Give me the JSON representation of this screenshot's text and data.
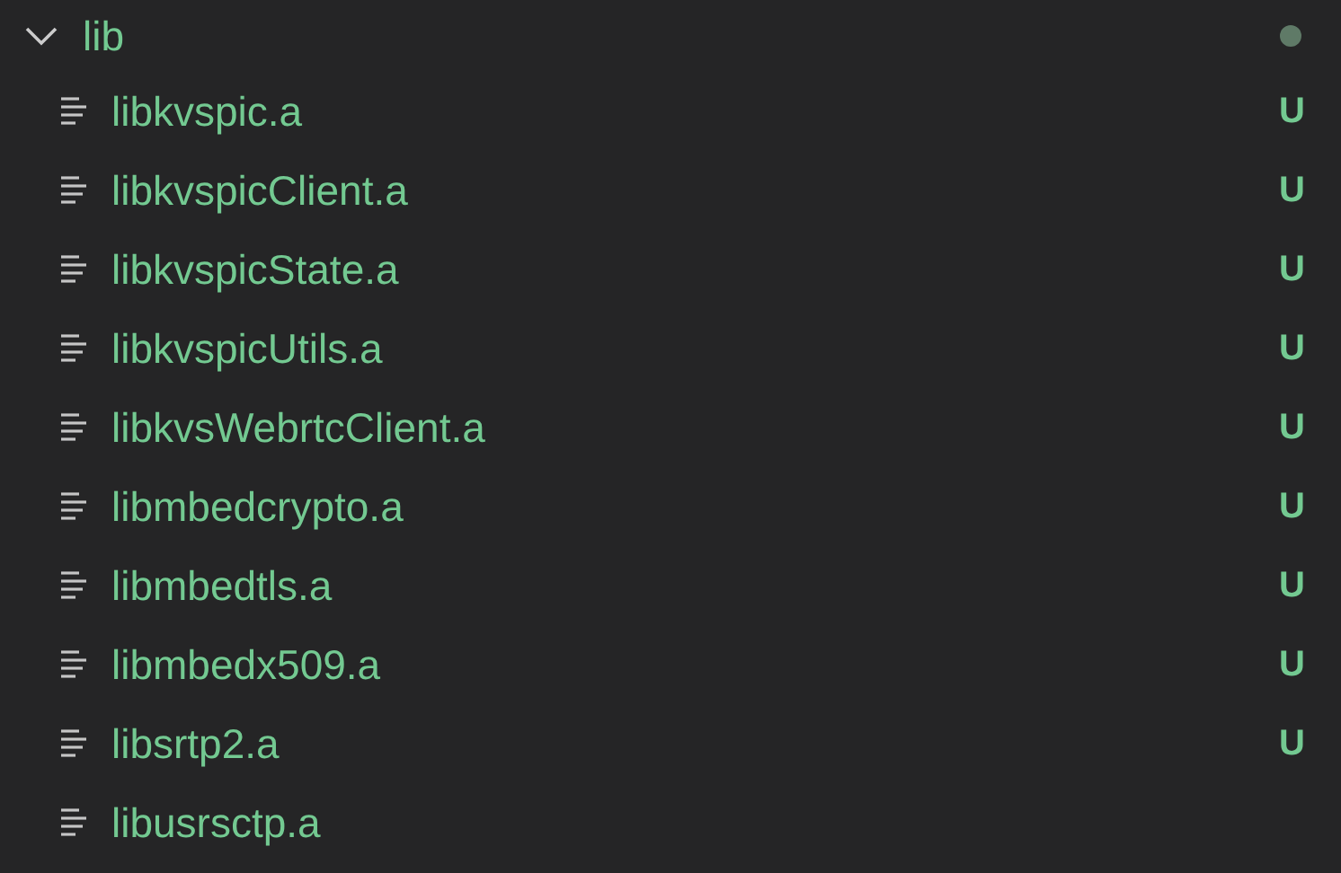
{
  "folder": {
    "name": "lib",
    "expanded": true,
    "has_changes": true,
    "children": [
      {
        "name": "libkvspic.a",
        "status": "U"
      },
      {
        "name": "libkvspicClient.a",
        "status": "U"
      },
      {
        "name": "libkvspicState.a",
        "status": "U"
      },
      {
        "name": "libkvspicUtils.a",
        "status": "U"
      },
      {
        "name": "libkvsWebrtcClient.a",
        "status": "U"
      },
      {
        "name": "libmbedcrypto.a",
        "status": "U"
      },
      {
        "name": "libmbedtls.a",
        "status": "U"
      },
      {
        "name": "libmbedx509.a",
        "status": "U"
      },
      {
        "name": "libsrtp2.a",
        "status": "U"
      },
      {
        "name": "libusrsctp.a"
      }
    ]
  }
}
